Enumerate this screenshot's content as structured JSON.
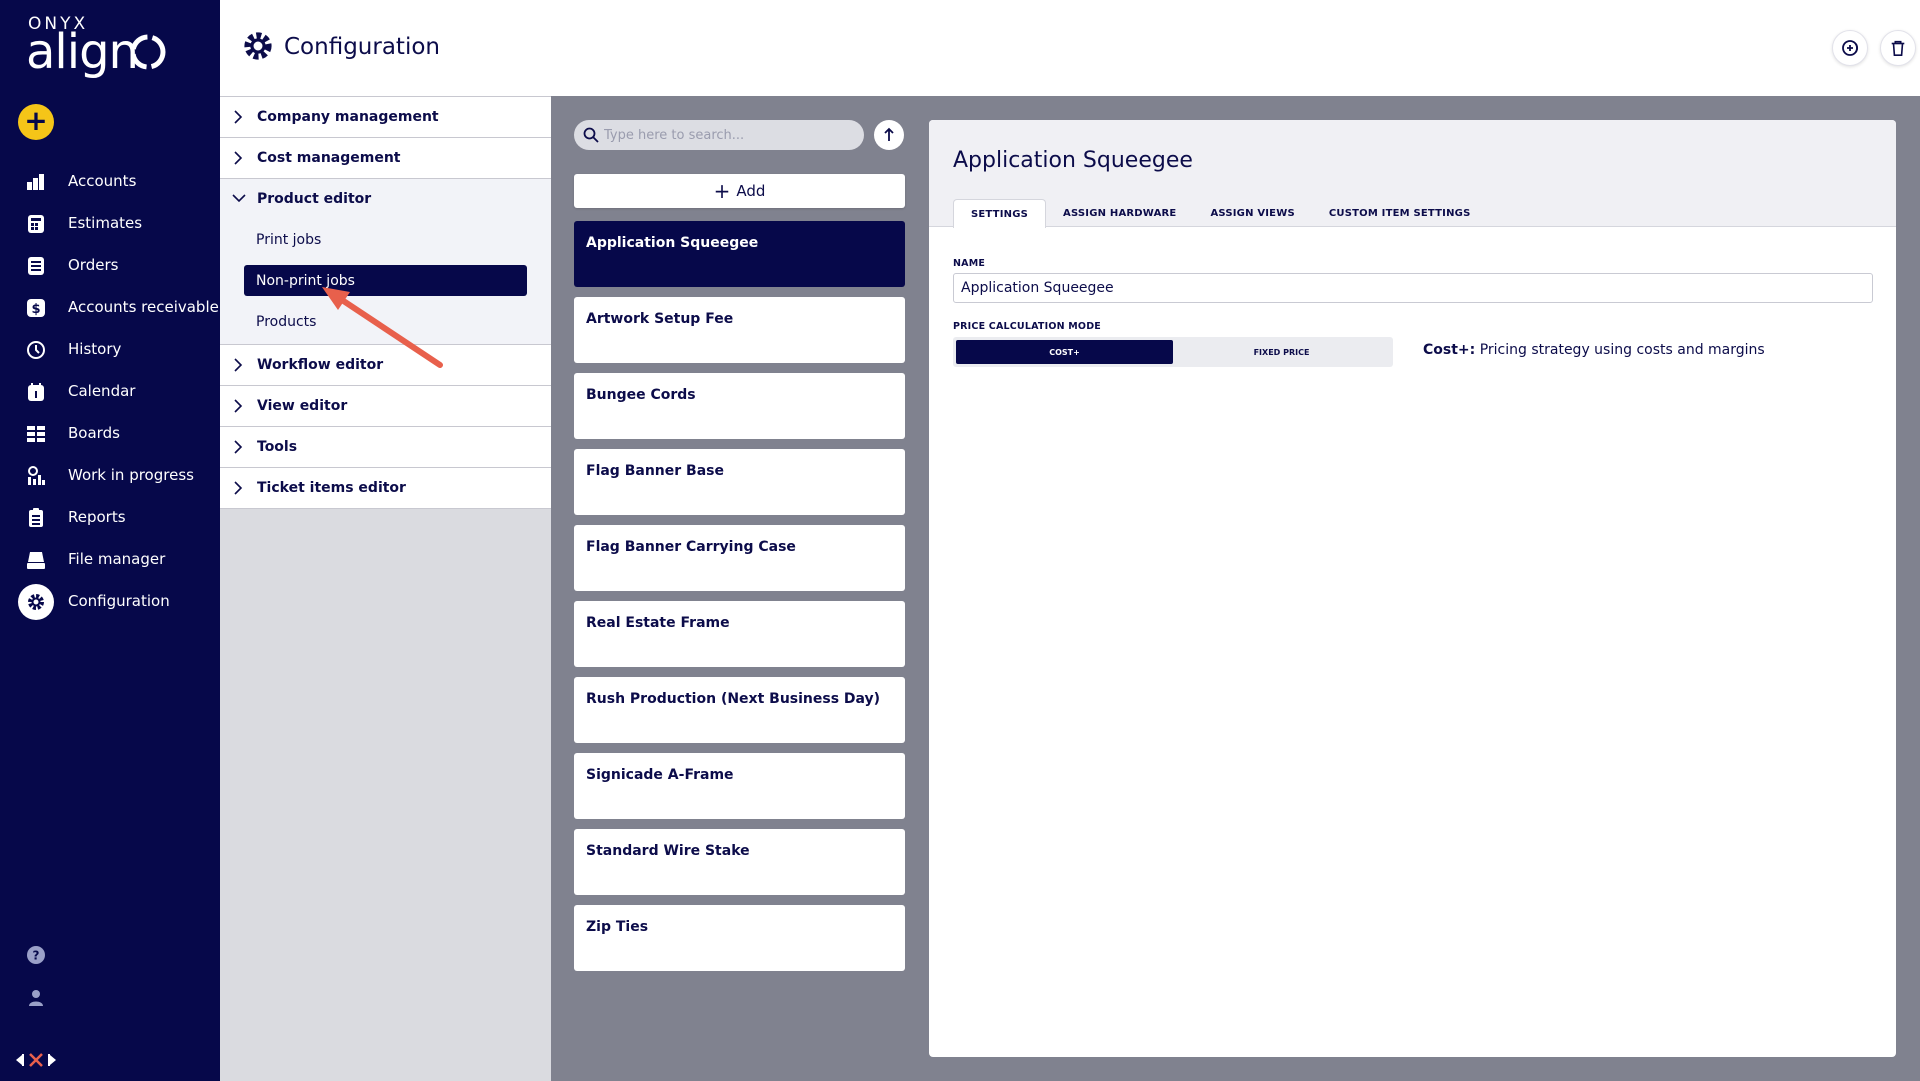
{
  "brand": {
    "top": "ONYX",
    "name": "align"
  },
  "sidebar": {
    "items": [
      {
        "label": "Accounts",
        "icon": "accounts-icon"
      },
      {
        "label": "Estimates",
        "icon": "estimates-icon"
      },
      {
        "label": "Orders",
        "icon": "orders-icon"
      },
      {
        "label": "Accounts receivable",
        "icon": "accounts-receivable-icon"
      },
      {
        "label": "History",
        "icon": "history-icon"
      },
      {
        "label": "Calendar",
        "icon": "calendar-icon"
      },
      {
        "label": "Boards",
        "icon": "boards-icon"
      },
      {
        "label": "Work in progress",
        "icon": "work-in-progress-icon"
      },
      {
        "label": "Reports",
        "icon": "reports-icon"
      },
      {
        "label": "File manager",
        "icon": "file-manager-icon"
      },
      {
        "label": "Configuration",
        "icon": "gear-icon",
        "active": true
      }
    ]
  },
  "header": {
    "title": "Configuration"
  },
  "tree": {
    "sections": [
      {
        "label": "Company management"
      },
      {
        "label": "Cost management"
      },
      {
        "label": "Product editor",
        "open": true
      },
      {
        "label": "Workflow editor"
      },
      {
        "label": "View editor"
      },
      {
        "label": "Tools"
      },
      {
        "label": "Ticket items editor"
      }
    ],
    "product_editor_items": [
      {
        "label": "Print jobs"
      },
      {
        "label": "Non-print jobs",
        "active": true
      },
      {
        "label": "Products"
      }
    ]
  },
  "list": {
    "search_placeholder": "Type here to search...",
    "add_label": "Add",
    "items": [
      "Application Squeegee",
      "Artwork Setup Fee",
      "Bungee Cords",
      "Flag Banner Base",
      "Flag Banner Carrying Case",
      "Real Estate Frame",
      "Rush Production (Next Business Day)",
      "Signicade A-Frame",
      "Standard Wire Stake",
      "Zip Ties"
    ],
    "selected_index": 0
  },
  "detail": {
    "title": "Application Squeegee",
    "tabs": [
      "SETTINGS",
      "ASSIGN HARDWARE",
      "ASSIGN VIEWS",
      "CUSTOM ITEM SETTINGS"
    ],
    "name_label": "NAME",
    "name_value": "Application Squeegee",
    "price_mode_label": "PRICE CALCULATION MODE",
    "price_modes": [
      "COST+",
      "FIXED PRICE"
    ],
    "mode_desc_bold": "Cost+:",
    "mode_desc": " Pricing strategy using costs and margins"
  },
  "colors": {
    "navy": "#06084a",
    "accent_yellow": "#f5c518",
    "annotation_arrow": "#e8604c",
    "list_bg": "#80828f"
  }
}
